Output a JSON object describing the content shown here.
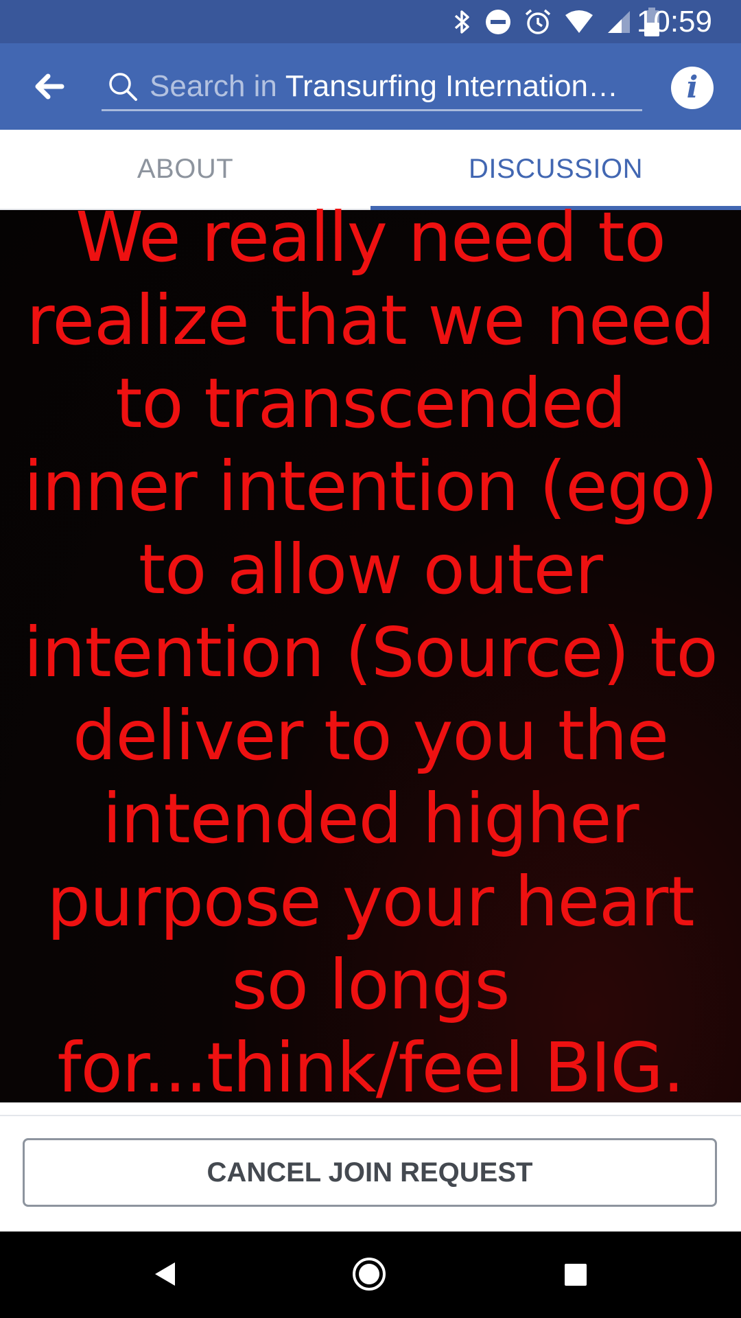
{
  "status_bar": {
    "time": "10:59",
    "icons": [
      "bluetooth-icon",
      "do-not-disturb-icon",
      "alarm-icon",
      "wifi-icon",
      "signal-icon",
      "battery-icon"
    ]
  },
  "app_bar": {
    "back_icon": "back-arrow-icon",
    "search": {
      "prefix": "Search in",
      "group_name": "Transurfing International Group"
    },
    "info_icon": "info-icon",
    "info_glyph": "i"
  },
  "tabs": [
    {
      "label": "ABOUT",
      "active": false
    },
    {
      "label": "DISCUSSION",
      "active": true
    }
  ],
  "cover": {
    "quote": "We really need to realize that we need to transcended inner intention (ego) to allow outer intention (Source) to deliver to you the intended higher purpose your heart so longs for...think/feel BIG."
  },
  "actions": {
    "cancel_join_label": "CANCEL JOIN REQUEST"
  },
  "nav_bar": {
    "icons": [
      "nav-back-icon",
      "nav-home-icon",
      "nav-recents-icon"
    ]
  },
  "colors": {
    "status_bar": "#39579a",
    "app_bar": "#4267b2",
    "quote_text": "#ee1111",
    "cover_bg": "#050303"
  }
}
